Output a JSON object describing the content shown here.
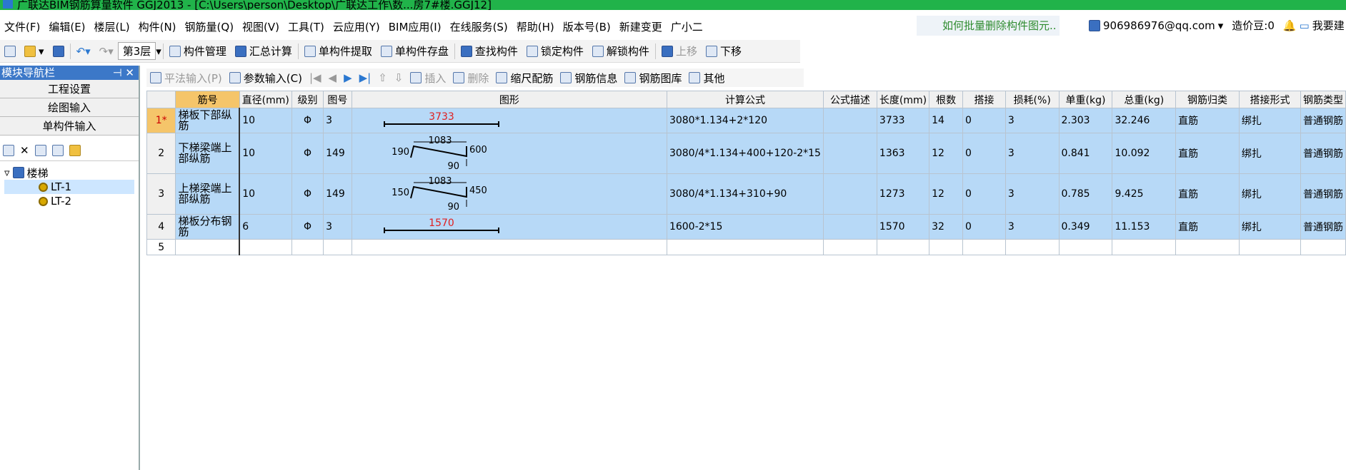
{
  "window": {
    "title": "广联达BIM钢筋算量软件 GGJ2013 - [C:\\Users\\person\\Desktop\\广联达工作\\数...房7#楼.GGJ12]"
  },
  "menu": [
    "文件(F)",
    "编辑(E)",
    "楼层(L)",
    "构件(N)",
    "钢筋量(Q)",
    "视图(V)",
    "工具(T)",
    "云应用(Y)",
    "BIM应用(I)",
    "在线服务(S)",
    "帮助(H)",
    "版本号(B)",
    "新建变更",
    "广小二"
  ],
  "hint": "如何批量删除构件图元..",
  "account": {
    "email": "906986976@qq.com",
    "coins": "造价豆:0",
    "help": "我要建"
  },
  "toolbar": {
    "floor": "第3层",
    "items": [
      "构件管理",
      "汇总计算",
      "单构件提取",
      "单构件存盘",
      "查找构件",
      "锁定构件",
      "解锁构件",
      "上移",
      "下移"
    ]
  },
  "nav": {
    "title": "模块导航栏",
    "sections": [
      "工程设置",
      "绘图输入",
      "单构件输入"
    ],
    "tree": {
      "root": "楼梯",
      "children": [
        "LT-1",
        "LT-2"
      ]
    }
  },
  "edit_toolbar": [
    "平法输入(P)",
    "参数输入(C)",
    "插入",
    "删除",
    "缩尺配筋",
    "钢筋信息",
    "钢筋图库",
    "其他"
  ],
  "table": {
    "columns": [
      "筋号",
      "直径(mm)",
      "级别",
      "图号",
      "图形",
      "计算公式",
      "公式描述",
      "长度(mm)",
      "根数",
      "搭接",
      "损耗(%)",
      "单重(kg)",
      "总重(kg)",
      "钢筋归类",
      "搭接形式",
      "钢筋类型"
    ],
    "rows": [
      {
        "rn": "1*",
        "name": "梯板下部纵筋",
        "dia": "10",
        "grade": "Φ",
        "fig": "3",
        "formula": "3080*1.134+2*120",
        "desc": "",
        "len": "3733",
        "count": "14",
        "lap": "0",
        "loss": "3",
        "uw": "2.303",
        "tw": "32.246",
        "cat": "直筋",
        "lapform": "绑扎",
        "type": "普通钢筋",
        "shape": {
          "kind": "straight",
          "label": "3733"
        }
      },
      {
        "rn": "2",
        "name": "下梯梁端上部纵筋",
        "dia": "10",
        "grade": "Φ",
        "fig": "149",
        "formula": "3080/4*1.134+400+120-2*15",
        "desc": "",
        "len": "1363",
        "count": "12",
        "lap": "0",
        "loss": "3",
        "uw": "0.841",
        "tw": "10.092",
        "cat": "直筋",
        "lapform": "绑扎",
        "type": "普通钢筋",
        "shape": {
          "kind": "bent",
          "top": "1083",
          "left": "190",
          "right": "600",
          "bottom": "90"
        }
      },
      {
        "rn": "3",
        "name": "上梯梁端上部纵筋",
        "dia": "10",
        "grade": "Φ",
        "fig": "149",
        "formula": "3080/4*1.134+310+90",
        "desc": "",
        "len": "1273",
        "count": "12",
        "lap": "0",
        "loss": "3",
        "uw": "0.785",
        "tw": "9.425",
        "cat": "直筋",
        "lapform": "绑扎",
        "type": "普通钢筋",
        "shape": {
          "kind": "bent",
          "top": "1083",
          "left": "150",
          "right": "450",
          "bottom": "90"
        }
      },
      {
        "rn": "4",
        "name": "梯板分布钢筋",
        "dia": "6",
        "grade": "Φ",
        "fig": "3",
        "formula": "1600-2*15",
        "desc": "",
        "len": "1570",
        "count": "32",
        "lap": "0",
        "loss": "3",
        "uw": "0.349",
        "tw": "11.153",
        "cat": "直筋",
        "lapform": "绑扎",
        "type": "普通钢筋",
        "shape": {
          "kind": "straight",
          "label": "1570"
        }
      },
      {
        "rn": "5",
        "empty": true
      }
    ]
  }
}
